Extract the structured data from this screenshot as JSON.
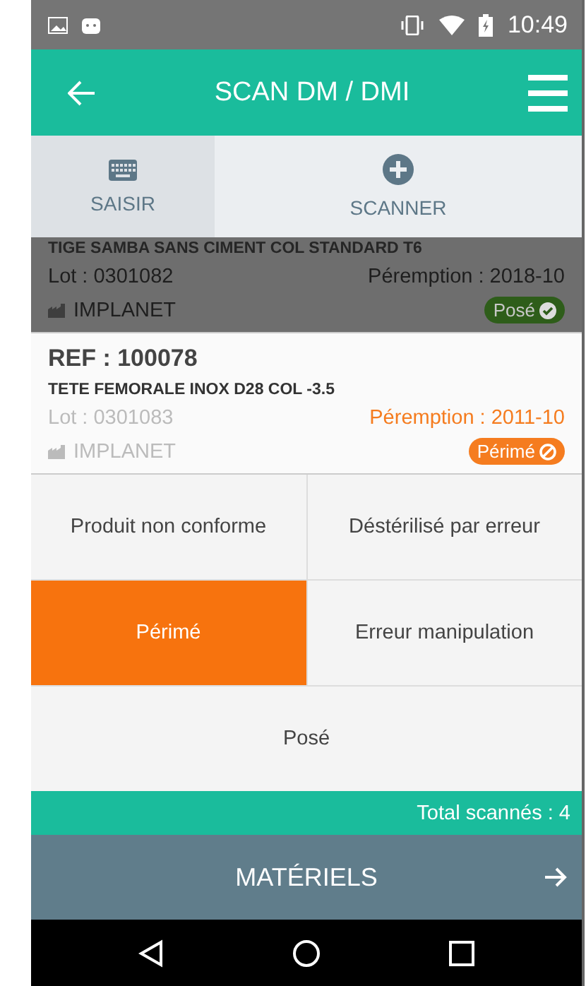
{
  "status_bar": {
    "time": "10:49"
  },
  "app_bar": {
    "title": "SCAN DM / DMI"
  },
  "tabs": [
    {
      "label": "SAISIR",
      "selected": true,
      "kind": "keyboard"
    },
    {
      "label": "SCANNER",
      "selected": false,
      "kind": "add"
    }
  ],
  "items": [
    {
      "name": "TIGE SAMBA SANS CIMENT COL STANDARD T6",
      "lot": "Lot : 0301082",
      "expiry": "Péremption : 2018-10",
      "expired": false,
      "maker": "IMPLANET",
      "status": "Posé",
      "kind": "pose",
      "dimmed": true
    },
    {
      "ref": "REF : 100078",
      "name": "TETE FEMORALE INOX D28 COL -3.5",
      "lot": "Lot : 0301083",
      "expiry": "Péremption : 2011-10",
      "expired": true,
      "maker": "IMPLANET",
      "status": "Périmé",
      "kind": "perime",
      "dimmed": false
    }
  ],
  "actions": [
    {
      "label": "Produit non conforme",
      "selected": false
    },
    {
      "label": "Déstérilisé par erreur",
      "selected": false
    },
    {
      "label": "Périmé",
      "selected": true
    },
    {
      "label": "Erreur manipulation",
      "selected": false
    },
    {
      "label": "Posé",
      "selected": false
    }
  ],
  "total": "Total scannés : 4",
  "footer_button": {
    "label": "MATÉRIELS"
  }
}
